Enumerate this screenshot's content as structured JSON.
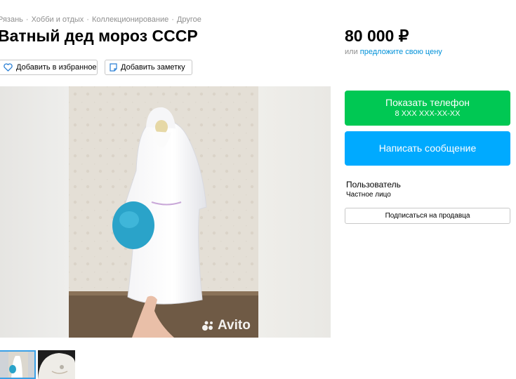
{
  "breadcrumb": [
    "Рязань",
    "Хобби и отдых",
    "Коллекционирование",
    "Другое"
  ],
  "breadcrumb_separator": "·",
  "title": "Ватный дед мороз СССР",
  "price": {
    "value": "80 000 ₽",
    "prefix": "или",
    "offer_link": "предложите свою цену"
  },
  "actions": {
    "favorite_label": "Добавить в избранное",
    "note_label": "Добавить заметку"
  },
  "gallery": {
    "watermark": "Avito",
    "thumbnail_count": 2,
    "selected_thumbnail": 1
  },
  "contact": {
    "show_phone_label": "Показать телефон",
    "phone_mask": "8 XXX XXX-XX-XX",
    "write_message_label": "Написать сообщение"
  },
  "seller": {
    "name": "Пользователь",
    "type": "Частное лицо",
    "subscribe_label": "Подписаться на продавца"
  },
  "colors": {
    "phone_button": "#00c853",
    "message_button": "#00aaff",
    "link": "#0091d9",
    "muted_text": "#8f8f8f"
  },
  "icons": [
    "heart-icon",
    "note-icon",
    "avito-logo-icon"
  ]
}
